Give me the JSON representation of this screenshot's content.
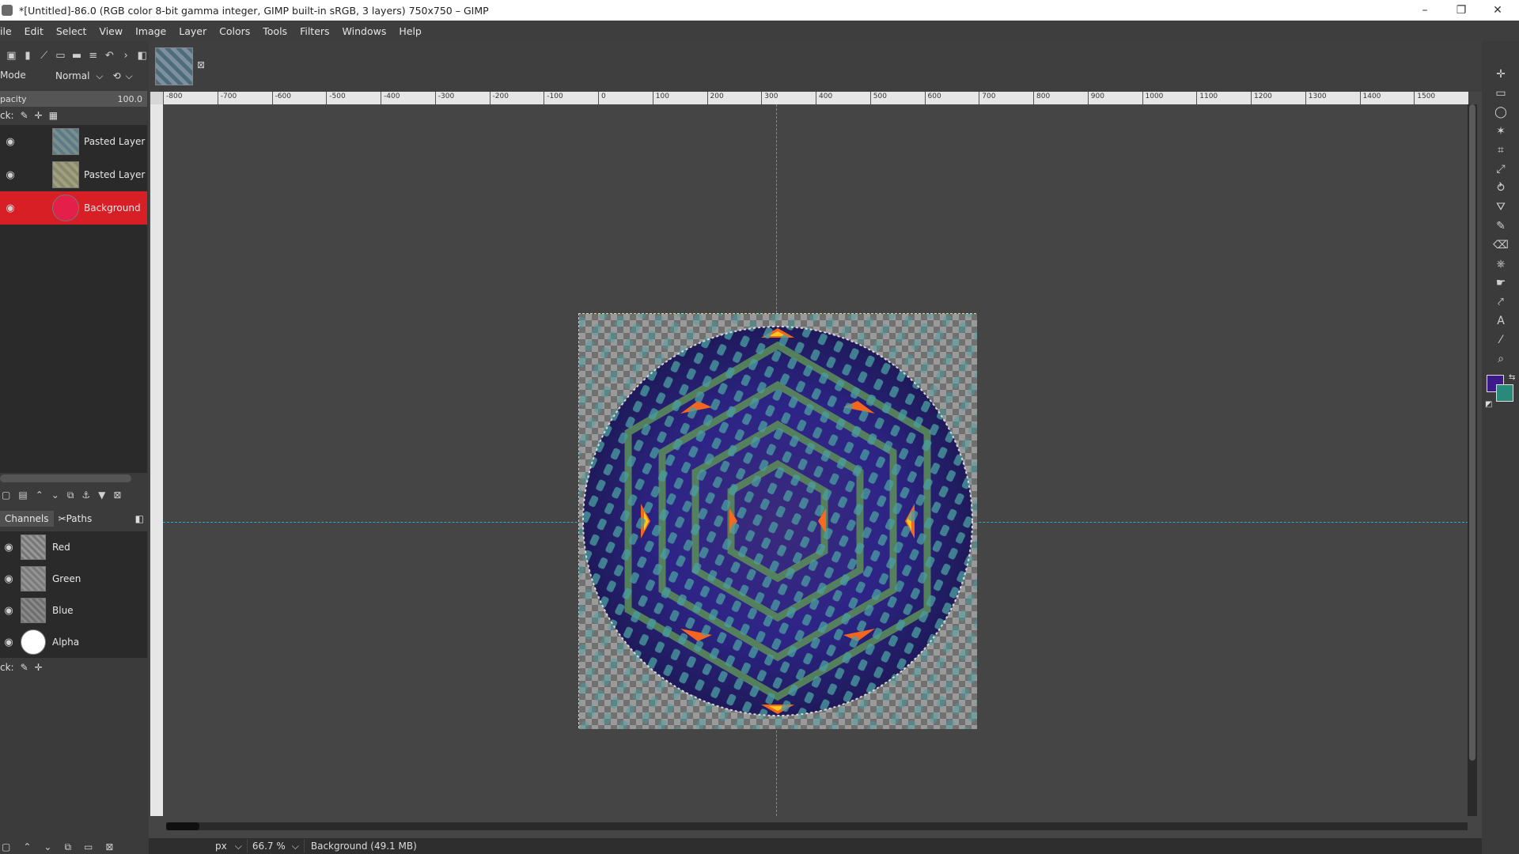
{
  "window": {
    "title": "*[Untitled]-86.0 (RGB color 8-bit gamma integer, GIMP built-in sRGB, 3 layers) 750x750 – GIMP",
    "controls": [
      "–",
      "❐",
      "✕"
    ]
  },
  "menu": [
    "ile",
    "Edit",
    "Select",
    "View",
    "Image",
    "Layer",
    "Colors",
    "Tools",
    "Filters",
    "Windows",
    "Help"
  ],
  "left_panel": {
    "mode_label": "Mode",
    "mode_value": "Normal",
    "opacity_label": "pacity",
    "opacity_value": "100.0",
    "lock_label": "ck:",
    "layers": [
      {
        "name": "Pasted Layer",
        "visible": true,
        "selected": false,
        "thumb_color": "#5b7a8a"
      },
      {
        "name": "Pasted Layer",
        "visible": true,
        "selected": false,
        "thumb_color": "#8a8a70"
      },
      {
        "name": "Background",
        "visible": true,
        "selected": true,
        "thumb_color": "#e31f4a"
      }
    ],
    "tabs": [
      "Channels",
      "Paths"
    ],
    "channels": [
      {
        "name": "Red",
        "thumb_color": "#8a8a8a"
      },
      {
        "name": "Green",
        "thumb_color": "#8c8c8c"
      },
      {
        "name": "Blue",
        "thumb_color": "#7a7a7a"
      },
      {
        "name": "Alpha",
        "thumb_color": "#ffffff"
      }
    ],
    "lock_label_2": "ck:"
  },
  "ruler": {
    "top_ticks": [
      "-800",
      "-700",
      "-600",
      "-500",
      "-400",
      "-300",
      "-200",
      "-100",
      "0",
      "100",
      "200",
      "300",
      "400",
      "500",
      "600",
      "700",
      "800",
      "900",
      "1000",
      "1100",
      "1200",
      "1300",
      "1400",
      "1500"
    ]
  },
  "status": {
    "unit": "px",
    "zoom": "66.7 %",
    "text": "Background (49.1 MB)"
  },
  "colors": {
    "fg": "#3d1a8a",
    "bg": "#2a8a7a",
    "accent_red": "#d81f26",
    "guide": "#30a8c8"
  }
}
